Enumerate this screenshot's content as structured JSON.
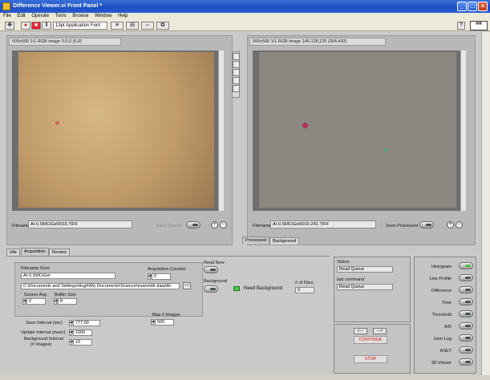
{
  "window": {
    "title": "Difference Viewer.vi Front Panel *"
  },
  "menu": [
    "File",
    "Edit",
    "Operate",
    "Tools",
    "Browse",
    "Window",
    "Help"
  ],
  "toolbar": {
    "font_select": "13pt Application Font",
    "help_label": "?"
  },
  "left_image": {
    "header": "500x500 1/1 RGB image 0,0,0   (0,0)",
    "filename_label": "Filename",
    "filename": "AI-0.SMCiGel0015.TIFF",
    "save_label": "Save Source"
  },
  "right_image": {
    "header": "500x500 1/1 RGB image 140,128,120   (304,433)",
    "filename_label": "Filename",
    "filename": "AI-0.SMCiGel0015-241.TIFF",
    "save_label": "Save Processed"
  },
  "image_tabs": [
    "Processed",
    "Background"
  ],
  "main_tabs": [
    "Idle",
    "Acquisition",
    "Review"
  ],
  "acquisition": {
    "filename_root_label": "Filename Root",
    "filename_root": "AI-0.SMCiGel",
    "path": "C:\\Documents and Settings\\Hugh\\My Documents\\Science\\evans\\dir data\\AI-",
    "acq_counter_label": "Acquisition Counter",
    "acq_counter": "0",
    "source_avg_label": "Source Avg",
    "source_avg": "2",
    "buffer_size_label": "Buffer Size",
    "buffer_size": "8",
    "save_interval_label": "Save Interval (sec)",
    "save_interval": "777.00",
    "update_interval_label": "Update Interval (msec)",
    "update_interval": "1000",
    "background_interval_label": "Background Interval",
    "background_interval_sub": "(# Images)",
    "background_interval": "10",
    "max_images_label": "Max # Images",
    "max_images": "500",
    "read_new_label": "Read New",
    "background_label": "Background",
    "need_background_label": "Need Background",
    "num_files_label": "# of Files",
    "num_files": "0"
  },
  "status": {
    "status_label": "Status",
    "status_value": "Read Queue",
    "last_command_label": "last command",
    "last_command_value": "Read Queue"
  },
  "controls": {
    "prev": "<---",
    "next": "--->",
    "continue_label": "CONTINUE",
    "stop_label": "STOP"
  },
  "toggles": [
    "Histogram",
    "Line Profile",
    "Difference",
    "Time",
    "Threshold",
    "A/D",
    "User Log",
    "ASET",
    "3D Viewer"
  ],
  "colors": {
    "title_bar": "#2a5cd0",
    "panel": "#c9c9c9",
    "indicator_green": "#40d040",
    "stop_red": "#d01010"
  }
}
